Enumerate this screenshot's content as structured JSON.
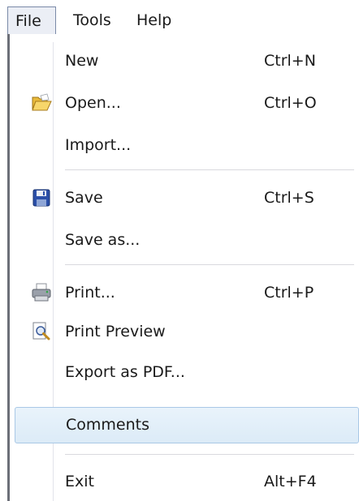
{
  "menubar": {
    "file": "File",
    "tools": "Tools",
    "help": "Help"
  },
  "file_menu": {
    "new": {
      "label": "New",
      "shortcut": "Ctrl+N"
    },
    "open": {
      "label": "Open...",
      "shortcut": "Ctrl+O",
      "icon": "folder-open-icon"
    },
    "import": {
      "label": "Import..."
    },
    "save": {
      "label": "Save",
      "shortcut": "Ctrl+S",
      "icon": "floppy-disk-icon"
    },
    "save_as": {
      "label": "Save as..."
    },
    "print": {
      "label": "Print...",
      "shortcut": "Ctrl+P",
      "icon": "printer-icon"
    },
    "print_preview": {
      "label": "Print Preview",
      "icon": "print-preview-icon"
    },
    "export_pdf": {
      "label": "Export as PDF..."
    },
    "comments": {
      "label": "Comments",
      "highlighted": true
    },
    "exit": {
      "label": "Exit",
      "shortcut": "Alt+F4"
    }
  },
  "colors": {
    "highlight_bg": "#dcebf7",
    "highlight_border": "#a9c8e6",
    "active_menu_bg": "#ebeef5"
  }
}
